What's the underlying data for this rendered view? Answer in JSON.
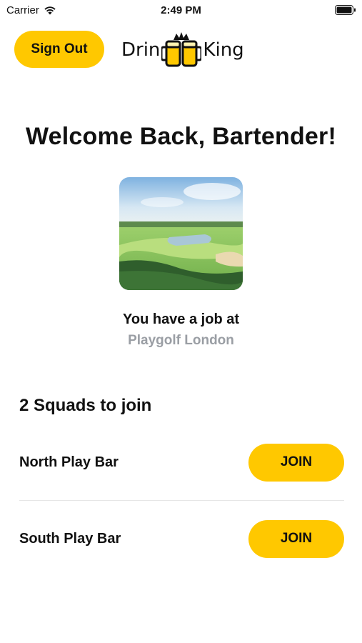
{
  "status_bar": {
    "carrier": "Carrier",
    "time": "2:49 PM"
  },
  "header": {
    "sign_out_label": "Sign Out",
    "logo_left": "Drin",
    "logo_right": "King"
  },
  "welcome": {
    "title": "Welcome Back, Bartender!",
    "image_icon": "golf-course-photo",
    "job_prefix": "You have a job at",
    "venue": "Playgolf London"
  },
  "squads": {
    "heading": "2 Squads to join",
    "items": [
      {
        "name": "North Play Bar",
        "action": "JOIN"
      },
      {
        "name": "South Play Bar",
        "action": "JOIN"
      }
    ]
  },
  "colors": {
    "accent": "#FFC800",
    "muted_text": "#9A9EA4"
  }
}
